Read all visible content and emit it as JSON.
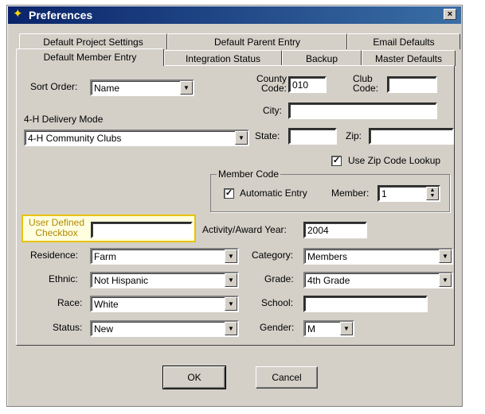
{
  "window": {
    "title": "Preferences",
    "close_label": "×"
  },
  "tabs_row1": [
    "Default Project Settings",
    "Default Parent Entry",
    "Email Defaults"
  ],
  "tabs_row2": [
    "Default Member Entry",
    "Integration Status",
    "Backup",
    "Master Defaults"
  ],
  "form": {
    "sort_order": {
      "label": "Sort Order:",
      "value": "Name"
    },
    "county_code": {
      "label1": "County",
      "label2": "Code:",
      "value": "010"
    },
    "club_code": {
      "label1": "Club",
      "label2": "Code:",
      "value": ""
    },
    "city": {
      "label": "City:",
      "value": ""
    },
    "delivery_mode": {
      "label": "4-H Delivery Mode",
      "value": "4-H Community Clubs"
    },
    "state": {
      "label": "State:",
      "value": ""
    },
    "zip": {
      "label": "Zip:",
      "value": ""
    },
    "zip_lookup": {
      "label": "Use Zip Code Lookup",
      "checked": "✓"
    },
    "member_code": {
      "title": "Member Code",
      "automatic_label": "Automatic Entry",
      "automatic_checked": "✓",
      "member_label": "Member:",
      "member_value": "1"
    },
    "user_defined": {
      "label1": "User Defined",
      "label2": "Checkbox",
      "value": ""
    },
    "activity_year": {
      "label": "Activity/Award Year:",
      "value": "2004"
    },
    "residence": {
      "label": "Residence:",
      "value": "Farm"
    },
    "category": {
      "label": "Category:",
      "value": "Members"
    },
    "ethnic": {
      "label": "Ethnic:",
      "value": "Not Hispanic"
    },
    "grade": {
      "label": "Grade:",
      "value": "4th Grade"
    },
    "race": {
      "label": "Race:",
      "value": "White"
    },
    "school": {
      "label": "School:",
      "value": ""
    },
    "status": {
      "label": "Status:",
      "value": "New"
    },
    "gender": {
      "label": "Gender:",
      "value": "M"
    }
  },
  "buttons": {
    "ok": "OK",
    "cancel": "Cancel"
  },
  "icons": {
    "dropdown": "▼",
    "spin_up": "▲",
    "spin_down": "▼",
    "app": "✦"
  },
  "colors": {
    "titlebar_start": "#0a246a",
    "titlebar_end": "#3a6ea5",
    "highlight_border": "#e8c300",
    "face": "#d4d0c8"
  }
}
